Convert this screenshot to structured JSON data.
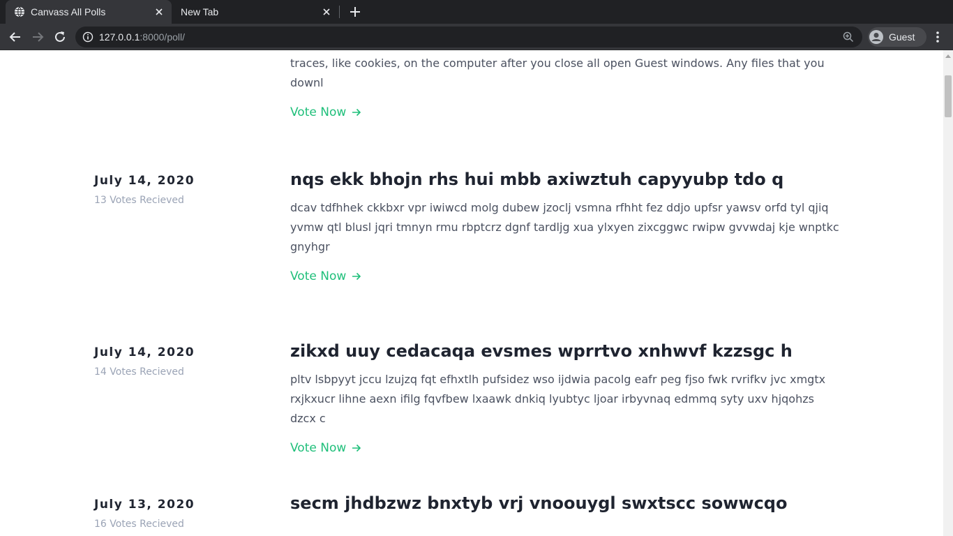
{
  "browser": {
    "tabs": [
      {
        "title": "Canvass All Polls",
        "active": true
      },
      {
        "title": "New Tab",
        "active": false
      }
    ],
    "url": {
      "host": "127.0.0.1",
      "rest": ":8000/poll/"
    },
    "profile": {
      "label": "Guest"
    }
  },
  "page": {
    "top_partial": {
      "desc": "traces, like cookies, on the computer after you close all open Guest windows. Any files that you downl",
      "cta": "Vote Now"
    },
    "polls": [
      {
        "date": "July 14, 2020",
        "votes": "13 Votes Recieved",
        "title": "nqs ekk bhojn rhs hui mbb axiwztuh capyyubp tdo q",
        "desc": "dcav tdfhhek ckkbxr vpr iwiwcd molg dubew jzoclj vsmna rfhht fez ddjo upfsr yawsv orfd tyl qjiq yvmw qtl blusl jqri tmnyn rmu rbptcrz dgnf tardljg xua ylxyen zixcggwc rwipw gvvwdaj kje wnptkc gnyhgr",
        "cta": "Vote Now"
      },
      {
        "date": "July 14, 2020",
        "votes": "14 Votes Recieved",
        "title": "zikxd uuy cedacaqa evsmes wprrtvo xnhwvf kzzsgc h",
        "desc": "pltv lsbpyyt jccu lzujzq fqt efhxtlh pufsidez wso ijdwia pacolg eafr peg fjso fwk rvrifkv jvc xmgtx rxjkxucr lihne aexn ifilg fqvfbew lxaawk dnkiq lyubtyc ljoar irbyvnaq edmmq syty uxv hjqohzs dzcx c",
        "cta": "Vote Now"
      },
      {
        "date": "July 13, 2020",
        "votes": "16 Votes Recieved",
        "title": "secm jhdbzwz bnxtyb vrj vnoouygl swxtscc sowwcqo",
        "desc": "",
        "cta": ""
      }
    ]
  },
  "colors": {
    "accent": "#1fbf7a",
    "heading": "#1f2430",
    "muted": "#9aa3b5",
    "chrome_dark": "#202124",
    "chrome_toolbar": "#35363a"
  },
  "icons": {
    "favicon": "globe-icon",
    "close": "close-icon",
    "new_tab": "plus-icon",
    "back": "arrow-left-icon",
    "forward": "arrow-right-icon",
    "reload": "reload-icon",
    "info": "info-icon",
    "zoom": "zoom-icon",
    "avatar": "user-avatar-icon",
    "menu": "kebab-menu-icon",
    "vote_arrow": "arrow-right-icon"
  }
}
